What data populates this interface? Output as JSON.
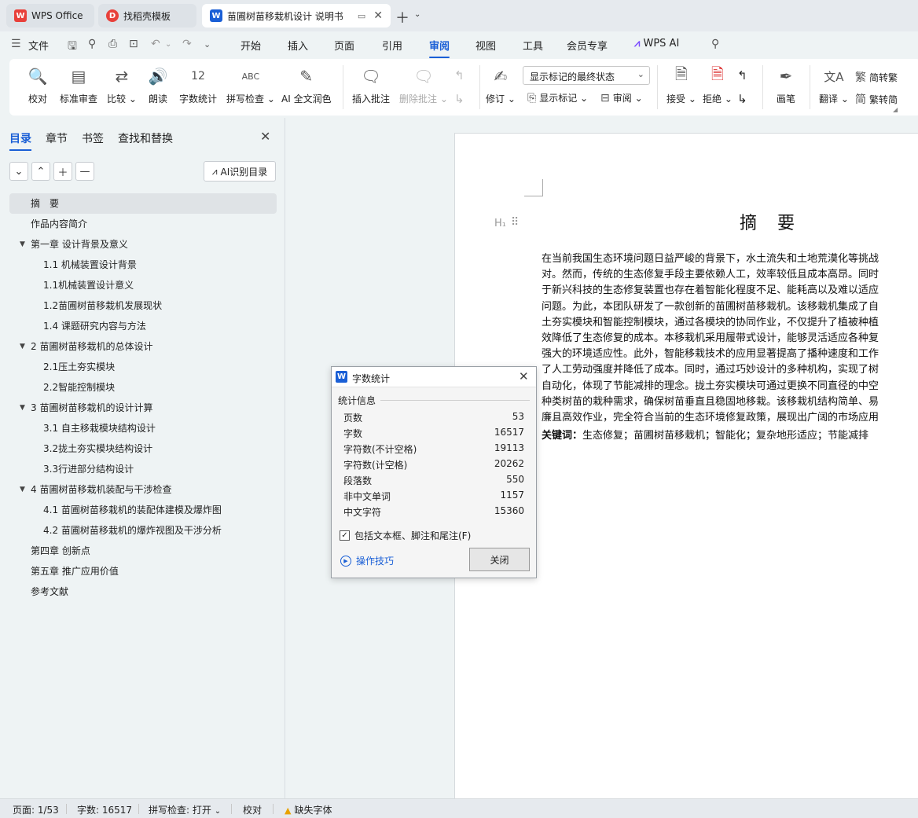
{
  "tabs": [
    {
      "label": "WPS Office",
      "icon": "W"
    },
    {
      "label": "找稻壳模板",
      "icon": "D"
    },
    {
      "label": "苗圃树苗移栽机设计 说明书",
      "icon": "W"
    }
  ],
  "menu": {
    "file": "文件",
    "items": [
      "开始",
      "插入",
      "页面",
      "引用",
      "审阅",
      "视图",
      "工具",
      "会员专享"
    ],
    "wps_ai": "WPS AI"
  },
  "ribbon": {
    "proofread": "校对",
    "standard_review": "标准审查",
    "compare": "比较",
    "read_aloud": "朗读",
    "word_count": "字数统计",
    "spell_check": "拼写检查",
    "ai_polish": "AI 全文润色",
    "insert_comment": "插入批注",
    "delete_comment": "删除批注",
    "track_changes": "修订",
    "markup_select": "显示标记的最终状态",
    "show_markup": "显示标记",
    "review_pane": "审阅",
    "accept": "接受",
    "reject": "拒绝",
    "pen": "画笔",
    "translate": "翻译",
    "to_traditional": "简转繁",
    "to_simplified": "繁转简"
  },
  "left_pane": {
    "tabs": [
      "目录",
      "章节",
      "书签",
      "查找和替换"
    ],
    "ai_toc": "AI识别目录",
    "toc": [
      {
        "label": "摘　要",
        "level": 1,
        "arrow": false,
        "active": true
      },
      {
        "label": "作品内容简介",
        "level": 1,
        "arrow": false
      },
      {
        "label": "第一章  设计背景及意义",
        "level": 1,
        "arrow": true
      },
      {
        "label": "1.1 机械装置设计背景",
        "level": 2,
        "arrow": false
      },
      {
        "label": "1.1机械装置设计意义",
        "level": 2,
        "arrow": false
      },
      {
        "label": "1.2苗圃树苗移栽机发展现状",
        "level": 2,
        "arrow": false
      },
      {
        "label": "1.4 课题研究内容与方法",
        "level": 2,
        "arrow": false
      },
      {
        "label": "2 苗圃树苗移栽机的总体设计",
        "level": 1,
        "arrow": true
      },
      {
        "label": "2.1压土夯实模块",
        "level": 2,
        "arrow": false
      },
      {
        "label": "2.2智能控制模块",
        "level": 2,
        "arrow": false
      },
      {
        "label": "3 苗圃树苗移栽机的设计计算",
        "level": 1,
        "arrow": true
      },
      {
        "label": "3.1 自主移栽模块结构设计",
        "level": 2,
        "arrow": false
      },
      {
        "label": "3.2拢土夯实模块结构设计",
        "level": 2,
        "arrow": false
      },
      {
        "label": "3.3行进部分结构设计",
        "level": 2,
        "arrow": false
      },
      {
        "label": "4 苗圃树苗移栽机装配与干涉检查",
        "level": 1,
        "arrow": true
      },
      {
        "label": "4.1  苗圃树苗移栽机的装配体建模及爆炸图",
        "level": 2,
        "arrow": false
      },
      {
        "label": "4.2 苗圃树苗移栽机的爆炸视图及干涉分析",
        "level": 2,
        "arrow": false
      },
      {
        "label": "第四章  创新点",
        "level": 1,
        "arrow": false
      },
      {
        "label": "第五章  推广应用价值",
        "level": 1,
        "arrow": false
      },
      {
        "label": "参考文献",
        "level": 1,
        "arrow": false
      }
    ]
  },
  "document": {
    "title": "摘　要",
    "lines": [
      "在当前我国生态环境问题日益严峻的背景下，水土流失和土地荒漠化等挑战",
      "对。然而，传统的生态修复手段主要依赖人工，效率较低且成本高昂。同时",
      "于新兴科技的生态修复装置也存在着智能化程度不足、能耗高以及难以适应",
      "问题。为此，本团队研发了一款创新的苗圃树苗移栽机。该移栽机集成了自",
      "土夯实模块和智能控制模块，通过各模块的协同作业，不仅提升了植被种植",
      "效降低了生态修复的成本。本移栽机采用履带式设计，能够灵活适应各种复",
      "强大的环境适应性。此外，智能移栽技术的应用显著提高了播种速度和工作",
      "了人工劳动强度并降低了成本。同时，通过巧妙设计的多种机构，实现了树",
      "自动化，体现了节能减排的理念。拢土夯实模块可通过更换不同直径的中空",
      "种类树苗的栽种需求，确保树苗垂直且稳固地移栽。该移栽机结构简单、易",
      "廉且高效作业，完全符合当前的生态环境修复政策，展现出广阔的市场应用"
    ],
    "keywords_label": "关键词：",
    "keywords": "生态修复；苗圃树苗移栽机；智能化；复杂地形适应；节能减排"
  },
  "dialog": {
    "title": "字数统计",
    "section": "统计信息",
    "rows": [
      {
        "label": "页数",
        "value": "53"
      },
      {
        "label": "字数",
        "value": "16517"
      },
      {
        "label": "字符数(不计空格)",
        "value": "19113"
      },
      {
        "label": "字符数(计空格)",
        "value": "20262"
      },
      {
        "label": "段落数",
        "value": "550"
      },
      {
        "label": "非中文单词",
        "value": "1157"
      },
      {
        "label": "中文字符",
        "value": "15360"
      }
    ],
    "include_label": "包括文本框、脚注和尾注(F)",
    "include_checked": true,
    "tips": "操作技巧",
    "close": "关闭"
  },
  "status": {
    "page": "页面: 1/53",
    "words": "字数: 16517",
    "spell": "拼写检查: 打开",
    "proof": "校对",
    "missing_font": "缺失字体"
  }
}
